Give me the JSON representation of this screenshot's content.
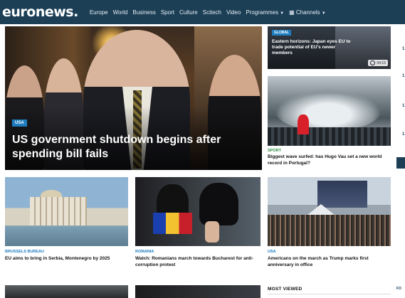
{
  "header": {
    "logo": "euronews.",
    "nav": [
      {
        "label": "Europe",
        "has_dropdown": false
      },
      {
        "label": "World",
        "has_dropdown": false
      },
      {
        "label": "Business",
        "has_dropdown": false
      },
      {
        "label": "Sport",
        "has_dropdown": false
      },
      {
        "label": "Culture",
        "has_dropdown": false
      },
      {
        "label": "Scitech",
        "has_dropdown": false
      },
      {
        "label": "Video",
        "has_dropdown": false
      },
      {
        "label": "Programmes",
        "has_dropdown": true
      },
      {
        "label": "Channels",
        "has_dropdown": true,
        "icon": "grid-icon"
      }
    ],
    "colors": {
      "bar": "#1c3f56",
      "text": "#ffffff"
    }
  },
  "hero": {
    "tag": "USA",
    "title": "US government shutdown begins after spending bill fails"
  },
  "right_column": {
    "card1": {
      "tag": "GLOBAL",
      "title": "Eastern horizons: Japan eyes EU to trade potential of EU's newer members",
      "badge": "04:15",
      "badge_icon": "play-icon"
    },
    "card2": {
      "category": "SPORT",
      "headline": "Biggest wave surfed: has Hugo Vau set a new world record in Portugal?"
    }
  },
  "row": [
    {
      "category": "BRUSSELS BUREAU",
      "headline": "EU aims to bring in Serbia, Montenegro by 2025"
    },
    {
      "category": "ROMANIA",
      "headline": "Watch: Romanians march towards Bucharest for anti-corruption protest"
    },
    {
      "category": "USA",
      "headline": "Americans on the march as Trump marks first anniversary in office"
    }
  ],
  "bottom": {
    "most_viewed_label": "MOST VIEWED",
    "edge_label": "FO"
  },
  "edge_numbers": [
    "1",
    "1",
    "1",
    "1"
  ],
  "accent_colors": {
    "tag_blue": "#1f7dbf",
    "sport_green": "#2a8c3e"
  }
}
